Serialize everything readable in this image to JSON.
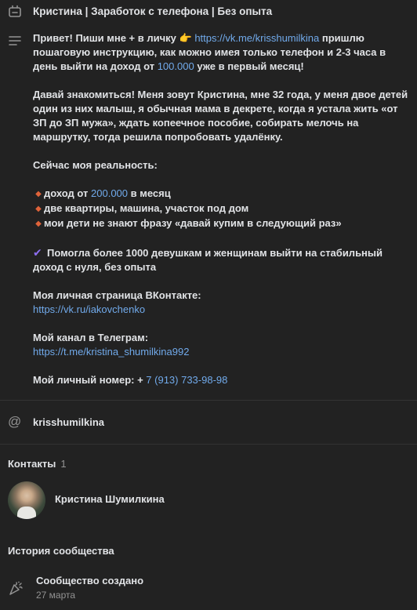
{
  "header": {
    "icon": "community-info-icon",
    "title": "Кристина | Заработок с телефона | Без опыта"
  },
  "description": {
    "icon": "lines-icon",
    "line1_pre": "Привет! Пиши мне + в личку ",
    "line1_emoji": "👉",
    "line1_link": "https://vk.me/krisshumilkina",
    "line1_post": " пришлю пошаговую инструкцию, как можно имея только телефон и 2-3 часа в день выйти на доход от ",
    "line1_num": "100.000",
    "line1_end": " уже в первый месяц!",
    "para2": "Давай знакомиться! Меня зовут Кристина, мне 32 года, у меня двое детей один из них малыш, я обычная  мама в декрете, когда я устала жить «от ЗП до ЗП мужа», ждать копеечное пособие, собирать мелочь на маршрутку, тогда решила попробовать удалёнку.",
    "reality_title": "Сейчас моя реальность:",
    "bullet1_pre": "доход от ",
    "bullet1_num": "200.000",
    "bullet1_post": " в месяц",
    "bullet2": "две квартиры, машина, участок под дом",
    "bullet3": "мои дети не знают фразу «давай купим в следующий раз»",
    "bullet_glyph": "◆",
    "check_glyph": "✔",
    "achievement": "Помогла более 1000 девушкам и женщинам выйти на стабильный доход с нуля, без опыта",
    "vk_title": "Моя личная страница ВКонтакте:",
    "vk_link": "https://vk.ru/iakovchenko",
    "tg_title": "Мой канал в Телеграм:",
    "tg_link": "https://t.me/kristina_shumilkina992",
    "phone_pre": "Мой личный номер: + ",
    "phone_num": "7 (913) 733-98-98"
  },
  "screen_name": {
    "icon": "at-icon",
    "glyph": "@",
    "value": "krisshumilkina"
  },
  "contacts": {
    "title": "Контакты",
    "count": "1",
    "items": [
      {
        "name": "Кристина Шумилкина",
        "avatar": "avatar"
      }
    ]
  },
  "history": {
    "title": "История сообщества",
    "items": [
      {
        "icon": "party-popper-icon",
        "title": "Сообщество создано",
        "date": "27 марта"
      }
    ]
  },
  "colors": {
    "background": "#222222",
    "text": "#e1e3e6",
    "link": "#71aaeb",
    "secondary": "#939393",
    "bullet": "#e0633a",
    "check": "#8d6ef0"
  }
}
